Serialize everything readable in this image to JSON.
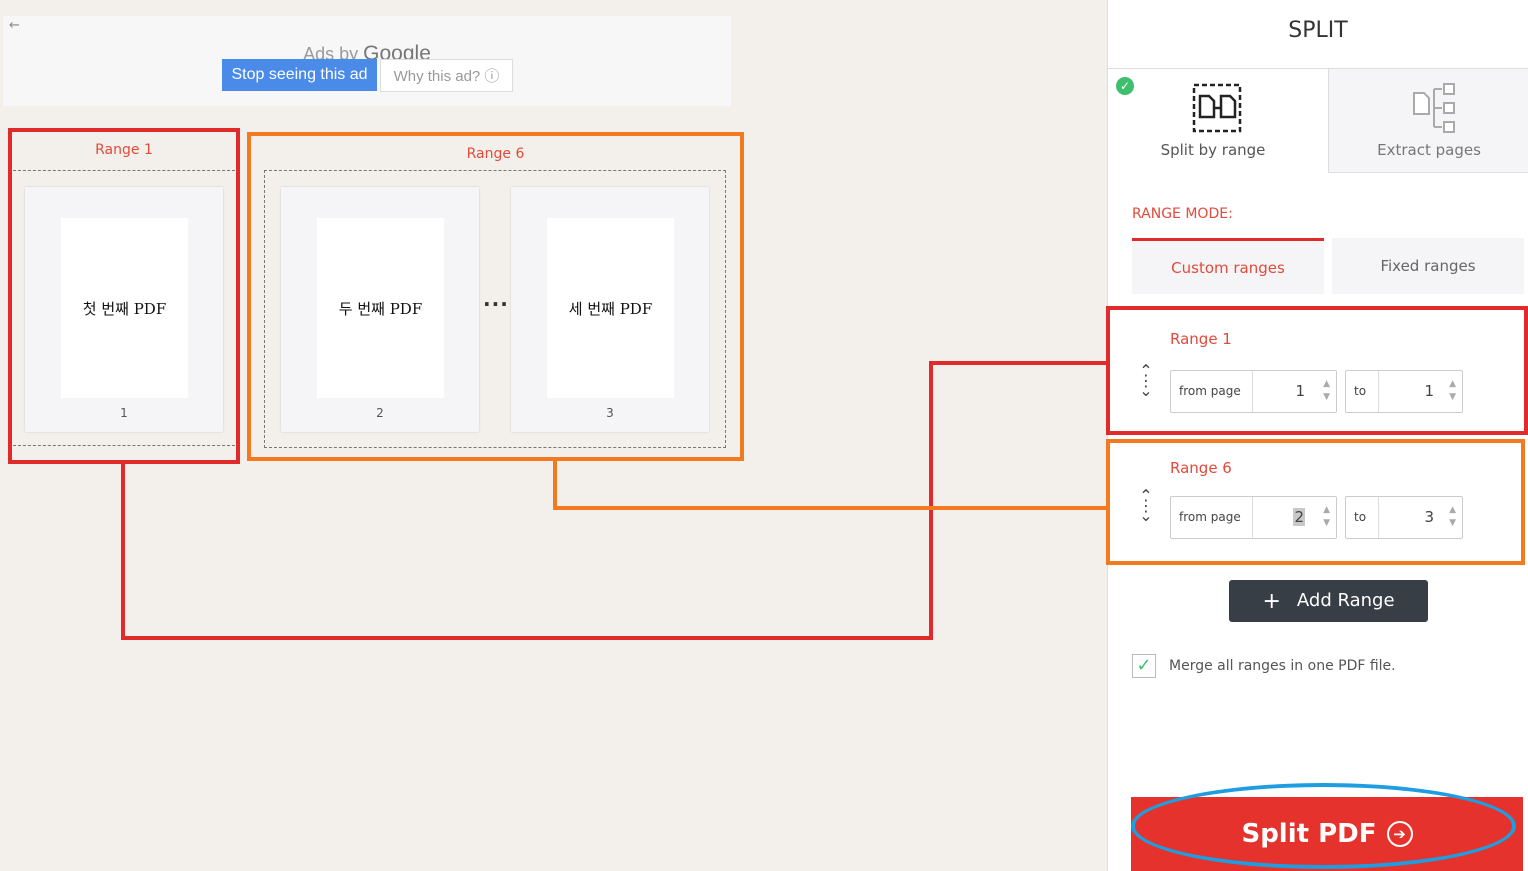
{
  "ad": {
    "back_glyph": "←",
    "title_prefix": "Ads by",
    "title_brand": "Google",
    "stop_label": "Stop seeing this ad",
    "why_label": "Why this ad? ⓘ"
  },
  "preview": {
    "groups": [
      {
        "label": "Range 1",
        "color": "#e12a2a"
      },
      {
        "label": "Range 6",
        "color": "#f47a20"
      }
    ],
    "pages": [
      {
        "text": "첫 번째 PDF",
        "number": "1"
      },
      {
        "text": "두 번째 PDF",
        "number": "2"
      },
      {
        "text": "세 번째 PDF",
        "number": "3"
      }
    ],
    "ellipsis": "···"
  },
  "sidebar": {
    "title": "SPLIT",
    "modes": [
      {
        "label": "Split by range",
        "icon": "split-by-range-icon",
        "selected": true
      },
      {
        "label": "Extract pages",
        "icon": "extract-pages-icon",
        "selected": false
      }
    ],
    "range_mode_label": "RANGE MODE:",
    "range_mode_options": [
      {
        "label": "Custom ranges",
        "active": true
      },
      {
        "label": "Fixed ranges",
        "active": false
      }
    ],
    "ranges": [
      {
        "name": "Range 1",
        "from_label": "from page",
        "from_value": "1",
        "to_label": "to",
        "to_value": "1"
      },
      {
        "name": "Range 6",
        "from_label": "from page",
        "from_value": "2",
        "to_label": "to",
        "to_value": "3"
      }
    ],
    "add_range_label": "Add Range",
    "merge_label": "Merge all ranges in one PDF file.",
    "merge_checked": true,
    "split_label": "Split PDF"
  },
  "colors": {
    "accent_red": "#e5322d",
    "highlight_red": "#e12a2a",
    "highlight_orange": "#f47a20",
    "highlight_blue": "#1e9ee0",
    "success_green": "#3fbf6e"
  }
}
